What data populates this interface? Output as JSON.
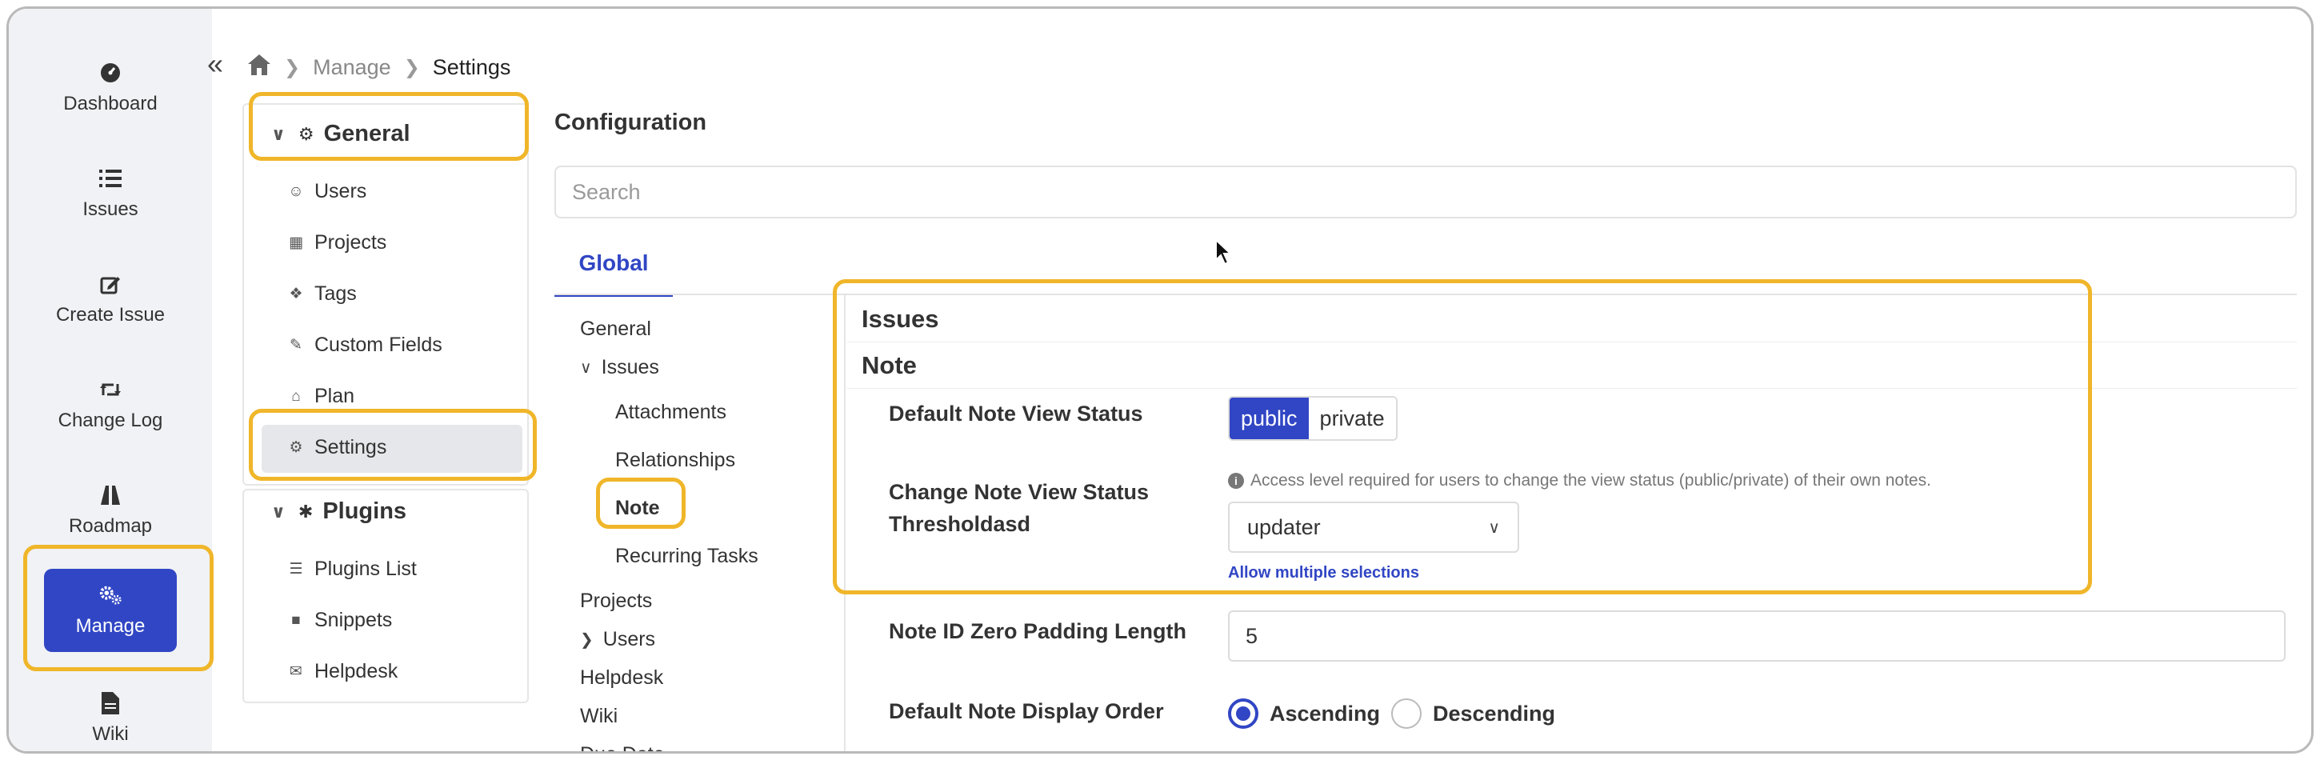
{
  "rail": {
    "items": [
      {
        "label": "Dashboard",
        "icon": "dashboard-icon"
      },
      {
        "label": "Issues",
        "icon": "list-icon"
      },
      {
        "label": "Create Issue",
        "icon": "edit-icon"
      },
      {
        "label": "Change Log",
        "icon": "retweet-icon"
      },
      {
        "label": "Roadmap",
        "icon": "road-icon"
      },
      {
        "label": "Manage",
        "icon": "cogs-icon"
      },
      {
        "label": "Wiki",
        "icon": "file-icon"
      }
    ],
    "active": "Manage"
  },
  "breadcrumb": {
    "home": "home-icon",
    "level1": "Manage",
    "current": "Settings"
  },
  "settings_nav": {
    "general_label": "General",
    "general_items": [
      "Users",
      "Projects",
      "Tags",
      "Custom Fields",
      "Plan",
      "Settings"
    ],
    "plugins_label": "Plugins",
    "plugin_items": [
      "Plugins List",
      "Snippets",
      "Helpdesk"
    ]
  },
  "main": {
    "title": "Configuration",
    "search_placeholder": "Search",
    "tab": "Global",
    "tree": {
      "general": "General",
      "issues": "Issues",
      "issues_children": [
        "Attachments",
        "Relationships",
        "Note",
        "Recurring Tasks"
      ],
      "projects": "Projects",
      "users": "Users",
      "helpdesk": "Helpdesk",
      "wiki": "Wiki",
      "due_date": "Due Date"
    },
    "section_issues": "Issues",
    "section_note": "Note",
    "default_view_label": "Default Note View Status",
    "view_options": [
      "public",
      "private"
    ],
    "view_selected": "public",
    "threshold_label": "Change Note View Status Thresholdasd",
    "threshold_help": "Access level required for users to change the view status (public/private) of their own notes.",
    "threshold_value": "updater",
    "allow_multiple": "Allow multiple selections",
    "padding_label": "Note ID Zero Padding Length",
    "padding_value": "5",
    "order_label": "Default Note Display Order",
    "order_options": [
      "Ascending",
      "Descending"
    ],
    "order_selected": "Ascending"
  },
  "colors": {
    "accent": "#3146c4",
    "highlight": "#f0b62a",
    "rail_bg": "#f1f2f5"
  }
}
